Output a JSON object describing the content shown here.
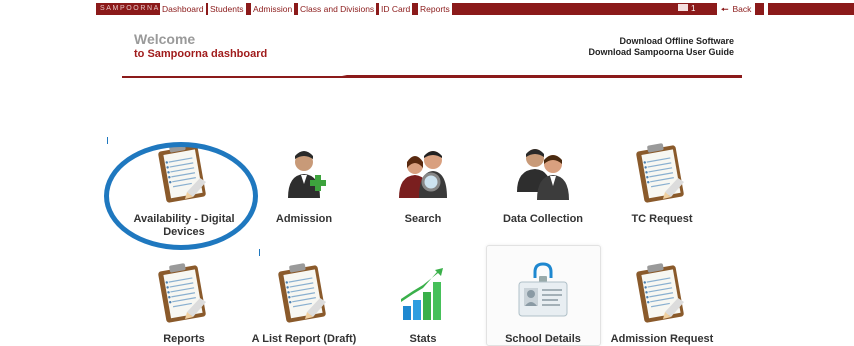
{
  "topbar": {
    "brand": "SAMPOORNA",
    "nav": [
      "Dashboard",
      "Students",
      "Admission",
      "Class and Divisions",
      "ID Card",
      "Reports"
    ],
    "mail_count": "1",
    "back_label": "Back"
  },
  "header": {
    "welcome": "Welcome",
    "subtitle": "to Sampoorna dashboard",
    "links": [
      "Download Offline Software",
      "Download Sampoorna User Guide"
    ]
  },
  "tiles_row1": [
    {
      "label": "Availability - Digital Devices",
      "icon": "clipboard-icon"
    },
    {
      "label": "Admission",
      "icon": "add-user-icon"
    },
    {
      "label": "Search",
      "icon": "user-search-icon"
    },
    {
      "label": "Data Collection",
      "icon": "users-group-icon"
    },
    {
      "label": "TC Request",
      "icon": "clipboard-icon"
    }
  ],
  "tiles_row2": [
    {
      "label": "Reports",
      "icon": "clipboard-icon"
    },
    {
      "label": "A List Report (Draft)",
      "icon": "clipboard-icon"
    },
    {
      "label": "Stats",
      "icon": "bar-chart-icon"
    },
    {
      "label": "School Details",
      "icon": "id-card-icon"
    },
    {
      "label": "Admission Request",
      "icon": "clipboard-icon"
    }
  ],
  "colors": {
    "brand": "#8b1a1a",
    "accent_red": "#a01c1c",
    "annotation_blue": "#1f78bf"
  }
}
